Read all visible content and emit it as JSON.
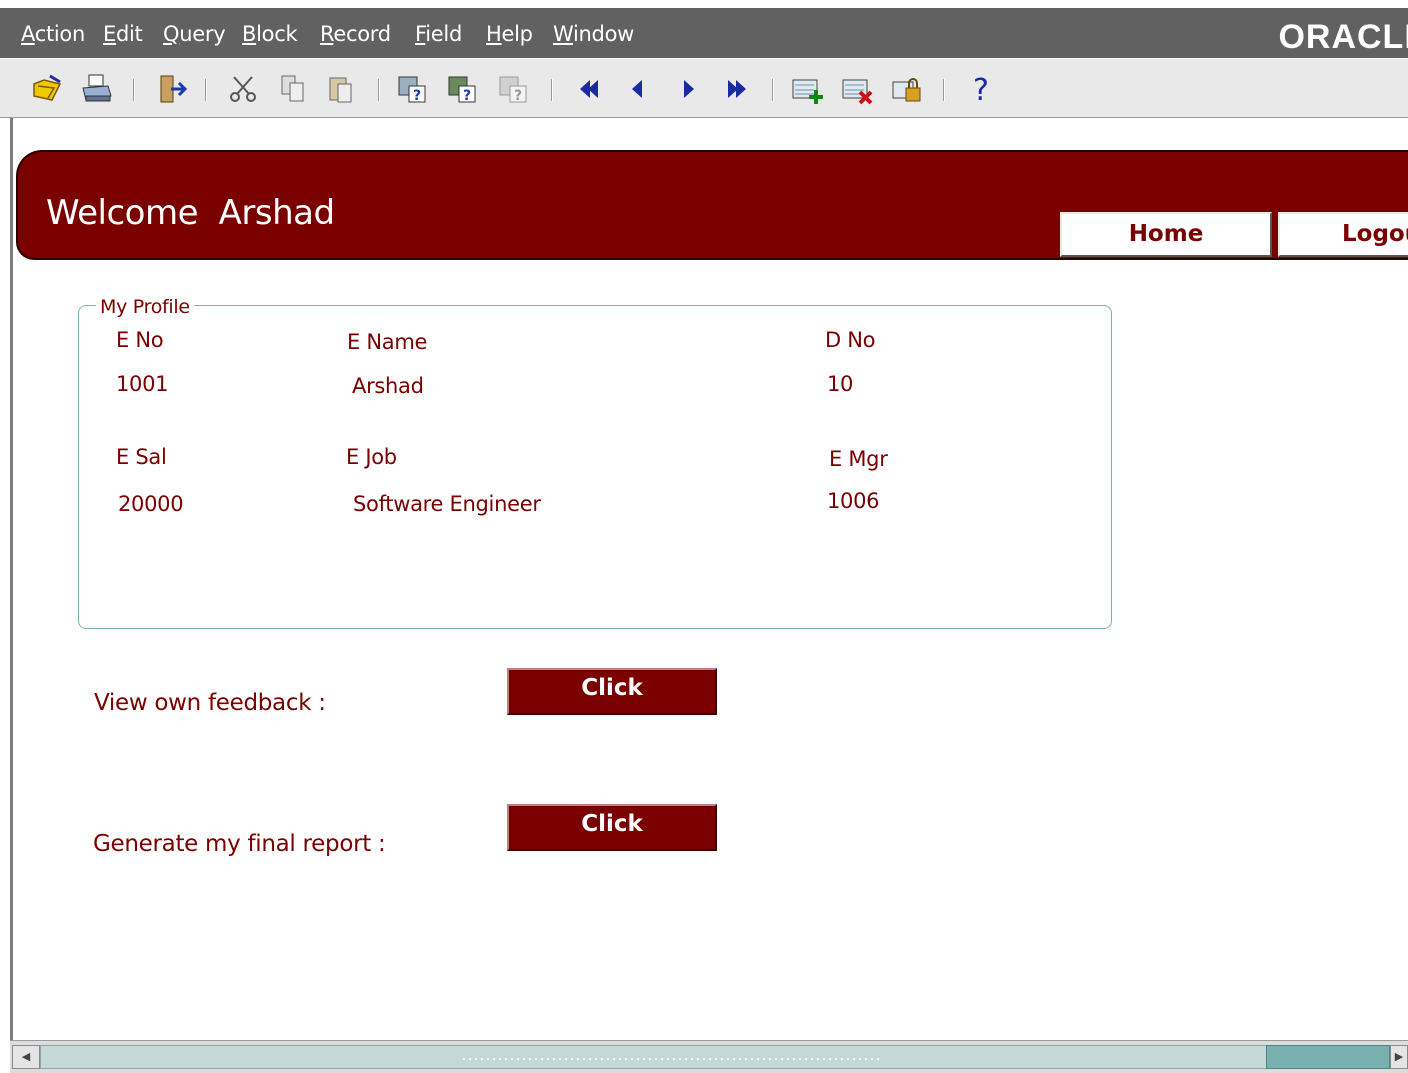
{
  "menu": {
    "items": [
      {
        "mnemonic": "A",
        "rest": "ction"
      },
      {
        "mnemonic": "E",
        "rest": "dit"
      },
      {
        "mnemonic": "Q",
        "rest": "uery"
      },
      {
        "mnemonic": "B",
        "rest": "lock"
      },
      {
        "mnemonic": "R",
        "rest": "ecord"
      },
      {
        "mnemonic": "F",
        "rest": "ield"
      },
      {
        "mnemonic": "H",
        "rest": "elp"
      },
      {
        "mnemonic": "W",
        "rest": "indow"
      }
    ],
    "logo": "ORACLE"
  },
  "toolbar": {
    "icons": [
      "save-icon",
      "print-icon",
      "exit-icon",
      "cut-icon",
      "copy-icon",
      "paste-icon",
      "enter-query-icon",
      "execute-query-icon",
      "cancel-query-icon",
      "first-record-icon",
      "previous-record-icon",
      "next-record-icon",
      "last-record-icon",
      "insert-record-icon",
      "delete-record-icon",
      "lock-record-icon",
      "help-icon"
    ]
  },
  "header": {
    "welcome": "Welcome  Arshad",
    "home_label": "Home",
    "logout_label": "Logout"
  },
  "profile": {
    "legend": "My Profile",
    "labels": {
      "eno": "E No",
      "ename": "E Name",
      "dno": "D No",
      "esal": "E Sal",
      "ejob": "E Job",
      "emgr": "E Mgr"
    },
    "values": {
      "eno": "1001",
      "ename": "Arshad",
      "dno": "10",
      "esal": "20000",
      "ejob": "Software Engineer",
      "emgr": "1006"
    }
  },
  "actions": {
    "feedback_label": "View own feedback :",
    "feedback_button": "Click",
    "report_label": "Generate my final report :",
    "report_button": "Click"
  },
  "colors": {
    "brand": "#7a0000",
    "menubar": "#616161",
    "frame_border": "#7fb0b0"
  }
}
